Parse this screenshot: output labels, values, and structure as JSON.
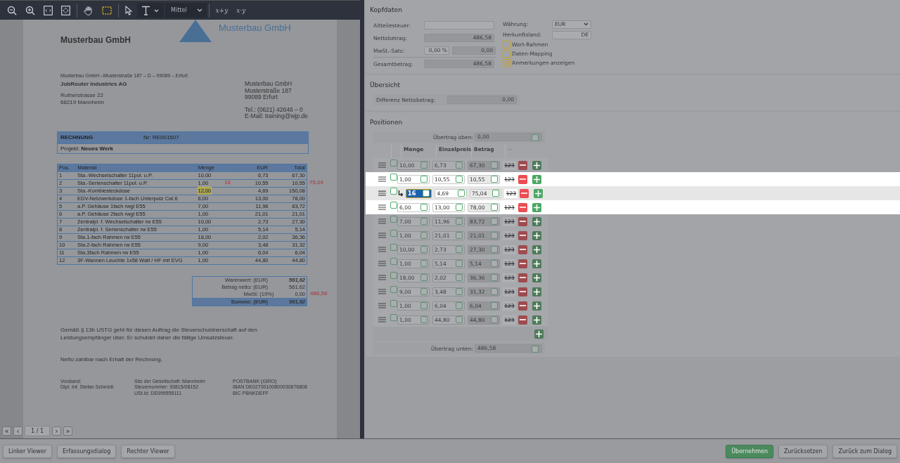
{
  "toolbar": {
    "tools": [
      {
        "kind": "zoom-out"
      },
      {
        "kind": "zoom-in"
      },
      {
        "kind": "fit-width"
      },
      {
        "kind": "fit-page"
      },
      {
        "kind": "hand"
      },
      {
        "kind": "select"
      },
      {
        "kind": "pointer"
      },
      {
        "kind": "text"
      }
    ],
    "size_select": "Mittel",
    "formula_buttons": [
      "x+y",
      "x·y"
    ]
  },
  "document": {
    "logo_text": "Musterbau GmbH",
    "sender_title": "Musterbau GmbH",
    "return_line": "Musterbau GmbH –Musterstraße 187 – D – 99089 – Erfurt",
    "recipient": {
      "name": "JobRouter Industries AG",
      "lines": [
        "Rutherstrasse 22",
        "68219 Mannheim"
      ]
    },
    "sender_address": [
      "Musterbau GmbH",
      "Musterstraße 187",
      "99089 Erfurt"
    ],
    "sender_contact": [
      "Tel.: (0621) 42646 – 0",
      "E-Mail: training@wjp.de"
    ],
    "invoice_title": "RECHNUNG",
    "invoice_number": "Nr: RE001507",
    "project": "Projekt: **Neues Werk**",
    "table": {
      "columns": [
        "Pos.",
        "Material",
        "Menge",
        "EUR",
        "Total"
      ],
      "rows": [
        {
          "cells": [
            "1",
            "Sta.-Wechselschalter 11pol. u.P.",
            "10,00",
            "6,73",
            "67,30"
          ],
          "marked": false
        },
        {
          "cells": [
            "2",
            "Sta.-Serienschalter 11pol. u.P.",
            "1,00",
            "10,55",
            "10,55"
          ],
          "marked": false
        },
        {
          "cells": [
            "3",
            "Sta.-Kombiesteckdose",
            "12,00",
            "4,69",
            "150,08"
          ],
          "marked": true
        },
        {
          "cells": [
            "4",
            "EDV-Netzwerkdose 1-fach Unterputz Cat 6",
            "6,00",
            "13,00",
            "78,00"
          ],
          "marked": false
        },
        {
          "cells": [
            "5",
            "a.P. Gehäuse 1fach rwgl E55",
            "7,00",
            "11,96",
            "83,72"
          ],
          "marked": false
        },
        {
          "cells": [
            "6",
            "a.P. Gehäuse 2fach rwgl E55",
            "1,00",
            "21,01",
            "21,01"
          ],
          "marked": false
        },
        {
          "cells": [
            "7",
            "Zentralpl. f. Wechselschalter rw E55",
            "10,00",
            "2,73",
            "27,30"
          ],
          "marked": false
        },
        {
          "cells": [
            "8",
            "Zentralpl. f. Serienschalter rw E55",
            "1,00",
            "5,14",
            "5,14"
          ],
          "marked": false
        },
        {
          "cells": [
            "9",
            "Sta.1-fach Rahmen rw E55",
            "18,00",
            "2,02",
            "36,36"
          ],
          "marked": false
        },
        {
          "cells": [
            "10",
            "Sta.2-fach Rahmen rw E55",
            "9,00",
            "3,48",
            "31,32"
          ],
          "marked": false
        },
        {
          "cells": [
            "11",
            "Sta.3fach Rahmen rw E55",
            "1,00",
            "6,04",
            "6,04"
          ],
          "marked": false
        },
        {
          "cells": [
            "12",
            "3F-Wannen Leuchte 1x58 Watt / HF mit EVG",
            "1,00",
            "44,80",
            "44,80"
          ],
          "marked": false
        }
      ]
    },
    "annotations": {
      "quantity": "16",
      "row_total": "75,04",
      "sum": "486,58"
    },
    "totals": [
      {
        "label": "Warenwert: (EUR)",
        "value": "561,62",
        "kind": "emph"
      },
      {
        "label": "Betrag netto: (EUR)",
        "value": "561,62",
        "kind": "plain"
      },
      {
        "label": "MwSt: (19%)",
        "value": "0,00",
        "kind": "plain"
      },
      {
        "label": "Summe: (EUR)",
        "value": "561,62",
        "kind": "sum"
      }
    ],
    "notes": [
      "Gemäß § 13b USTG geht für diesen Auftrag die Steuerschuldnerschaft auf den Leistungsempfänger über. Er schuldet daher die fällige Umsatzsteuer.",
      "Netto zahlbar nach Erhalt der Rechnung."
    ],
    "footer": [
      [
        "Vorstand:",
        "Dipl. Inf. Stefan Schmidt"
      ],
      [
        "Sitz der Gesellschaft: Mannheim",
        "Steuernummer: 93815/08152",
        "USt.Id: DE999555111"
      ],
      [
        "POSTBANK (GIRO)",
        "IBAN DE02700100800030876808",
        "BIC PBNKDEFF"
      ]
    ]
  },
  "pager": {
    "first": "«",
    "prev": "‹",
    "page": "1 / 1",
    "next": "›",
    "last": "»"
  },
  "kopfdaten": {
    "title": "Kopfdaten",
    "altteilesteuer": {
      "label": "Altteilesteuer:"
    },
    "nettobetrag": {
      "label": "Nettobetrag:",
      "value": "486,58"
    },
    "mwst": {
      "label": "MwSt.-Satz:",
      "rate": "0,00 %",
      "value": "0,00"
    },
    "gesamtbetrag": {
      "label": "Gesamtbetrag:",
      "value": "486,58"
    },
    "waehrung": {
      "label": "Währung:",
      "value": "EUR"
    },
    "herkunftsland": {
      "label": "Herkunftsland:",
      "value": "DE"
    },
    "options": [
      {
        "label": "Wort-Rahmen",
        "checked": false
      },
      {
        "label": "Daten-Mapping",
        "checked": false
      },
      {
        "label": "Anmerkungen anzeigen",
        "checked": true
      }
    ]
  },
  "uebersicht": {
    "title": "Übersicht",
    "label": "Differenz Nettobetrag:",
    "value": "0,00"
  },
  "positionen": {
    "title": "Positionen",
    "carry_top": {
      "label": "Übertrag oben:",
      "value": "0,00",
      "checked": false
    },
    "columns": [
      "Menge",
      "Einzelpreis",
      "Betrag",
      "···"
    ],
    "rows": [
      {
        "menge": "10,00",
        "preis": "6,73",
        "betrag": "67,30",
        "format": "123",
        "highlighted": false,
        "active": false
      },
      {
        "menge": "1,00",
        "preis": "10,55",
        "betrag": "10,55",
        "format": "123",
        "highlighted": true,
        "active": false
      },
      {
        "menge": "16",
        "preis": "4,69",
        "betrag": "75,04",
        "format": "123",
        "highlighted": true,
        "active": true
      },
      {
        "menge": "6,00",
        "preis": "13,00",
        "betrag": "78,00",
        "format": "123",
        "highlighted": true,
        "active": false
      },
      {
        "menge": "7,00",
        "preis": "11,96",
        "betrag": "83,72",
        "format": "123",
        "highlighted": false,
        "active": false
      },
      {
        "menge": "1,00",
        "preis": "21,01",
        "betrag": "21,01",
        "format": "123",
        "highlighted": false,
        "active": false
      },
      {
        "menge": "10,00",
        "preis": "2,73",
        "betrag": "27,30",
        "format": "123",
        "highlighted": false,
        "active": false
      },
      {
        "menge": "1,00",
        "preis": "5,14",
        "betrag": "5,14",
        "format": "123",
        "highlighted": false,
        "active": false
      },
      {
        "menge": "18,00",
        "preis": "2,02",
        "betrag": "36,36",
        "format": "123",
        "highlighted": false,
        "active": false
      },
      {
        "menge": "9,00",
        "preis": "3,48",
        "betrag": "31,32",
        "format": "123",
        "highlighted": false,
        "active": false
      },
      {
        "menge": "1,00",
        "preis": "6,04",
        "betrag": "6,04",
        "format": "123",
        "highlighted": false,
        "active": false
      },
      {
        "menge": "1,00",
        "preis": "44,80",
        "betrag": "44,80",
        "format": "123",
        "highlighted": false,
        "active": false
      }
    ],
    "carry_bottom": {
      "label": "Übertrag unten:",
      "value": "486,58",
      "checked": false
    }
  },
  "bottom_bar": {
    "left": [
      "Linker Viewer",
      "Erfassungsdialog",
      "Rechter Viewer"
    ],
    "right": [
      {
        "label": "Übernehmen",
        "primary": true
      },
      {
        "label": "Zurücksetzen",
        "primary": false
      },
      {
        "label": "Zurück zum Dialog",
        "primary": false
      }
    ]
  }
}
